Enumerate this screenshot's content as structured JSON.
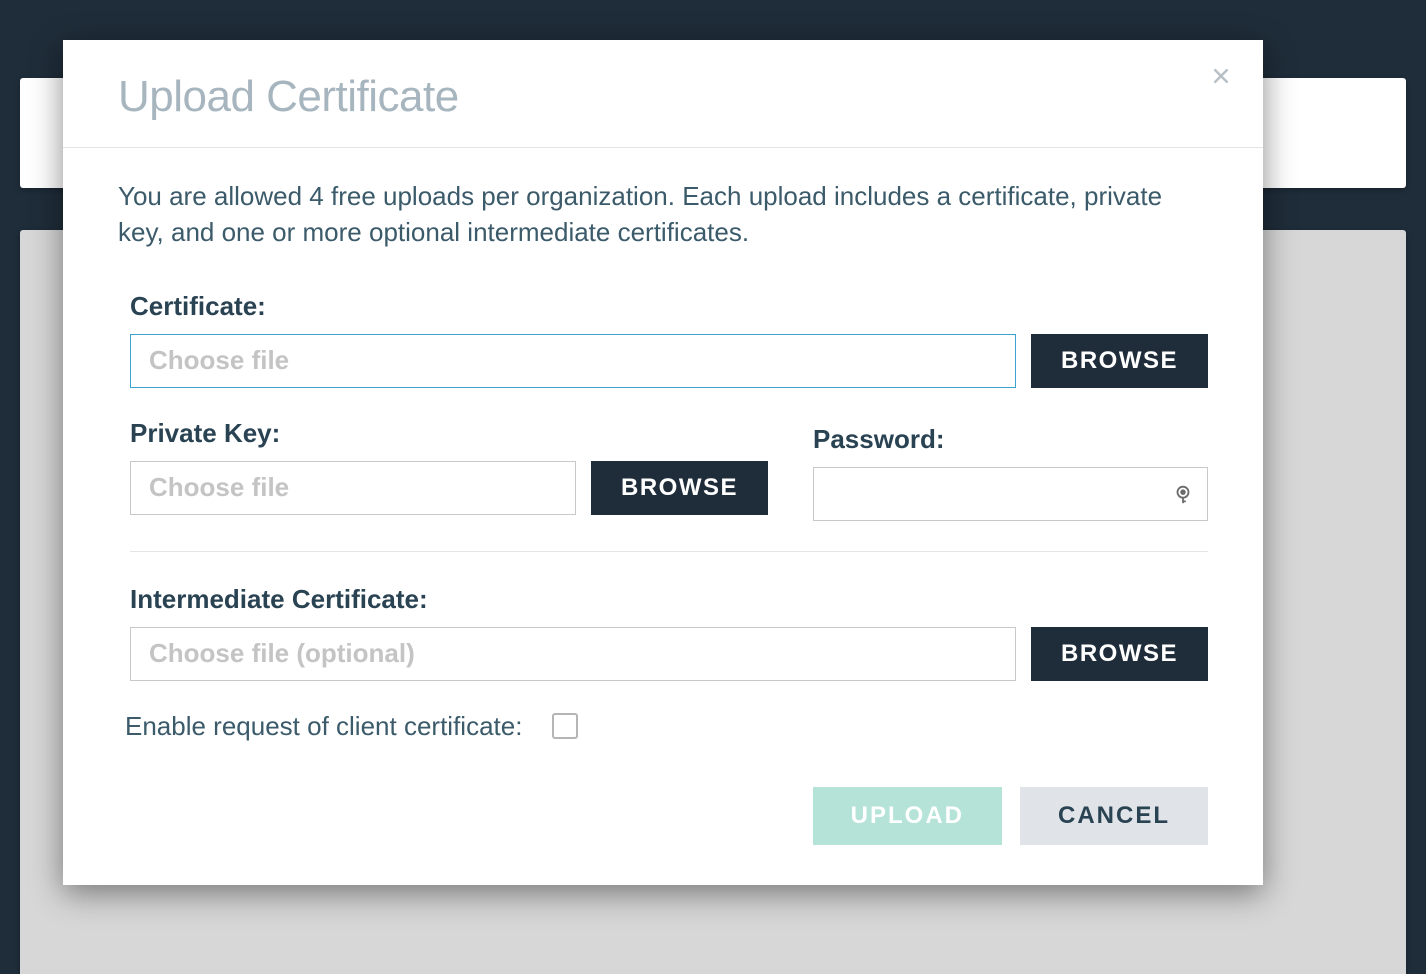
{
  "modal": {
    "title": "Upload Certificate",
    "intro": "You are allowed 4 free uploads per organization. Each upload includes a certificate, private key, and one or more optional intermediate certificates.",
    "certificate": {
      "label": "Certificate:",
      "placeholder": "Choose file",
      "browse": "BROWSE"
    },
    "private_key": {
      "label": "Private Key:",
      "placeholder": "Choose file",
      "browse": "BROWSE"
    },
    "password": {
      "label": "Password:",
      "value": ""
    },
    "intermediate": {
      "label": "Intermediate Certificate:",
      "placeholder": "Choose file (optional)",
      "browse": "BROWSE"
    },
    "client_cert_checkbox": {
      "label": "Enable request of client certificate:",
      "checked": false
    },
    "actions": {
      "upload": "UPLOAD",
      "cancel": "CANCEL"
    }
  }
}
